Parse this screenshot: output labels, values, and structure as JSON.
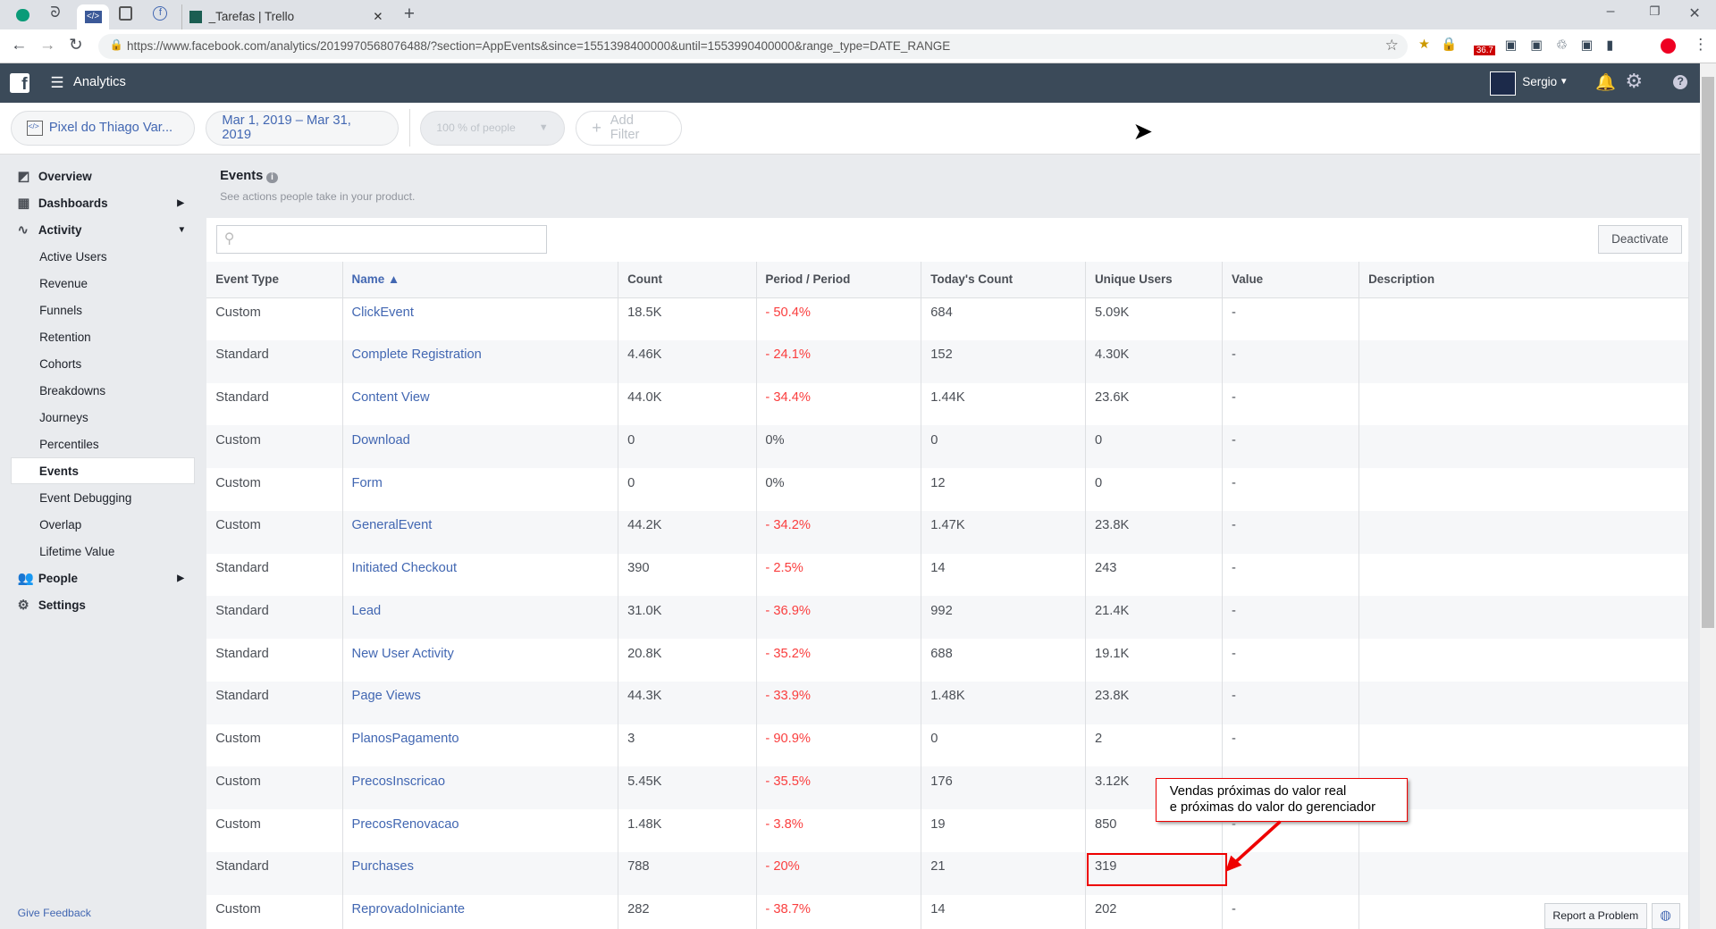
{
  "browser": {
    "tabs": [
      "_Tarefas | Trello"
    ],
    "url": "https://www.facebook.com/analytics/2019970568076488/?section=AppEvents&since=1551398400000&until=1553990400000&range_type=DATE_RANGE",
    "ext_badge": "36.7"
  },
  "header": {
    "app": "Analytics",
    "user": "Sergio"
  },
  "filters": {
    "pixel": "Pixel do Thiago Var...",
    "date": "Mar 1, 2019 – Mar 31, 2019",
    "people": "100 % of people",
    "add_filter": "Add Filter"
  },
  "sidebar": {
    "overview": "Overview",
    "dashboards": "Dashboards",
    "activity": "Activity",
    "sub": [
      "Active Users",
      "Revenue",
      "Funnels",
      "Retention",
      "Cohorts",
      "Breakdowns",
      "Journeys",
      "Percentiles",
      "Events",
      "Event Debugging",
      "Overlap",
      "Lifetime Value"
    ],
    "people": "People",
    "settings": "Settings",
    "feedback": "Give Feedback"
  },
  "page": {
    "title": "Events",
    "subtitle": "See actions people take in your product.",
    "deactivate": "Deactivate",
    "report": "Report a Problem"
  },
  "table": {
    "headers": [
      "Event Type",
      "Name ▲",
      "Count",
      "Period / Period",
      "Today's Count",
      "Unique Users",
      "Value",
      "Description"
    ],
    "rows": [
      [
        "Custom",
        "ClickEvent",
        "18.5K",
        "- 50.4%",
        "684",
        "5.09K",
        "-",
        ""
      ],
      [
        "Standard",
        "Complete Registration",
        "4.46K",
        "- 24.1%",
        "152",
        "4.30K",
        "-",
        ""
      ],
      [
        "Standard",
        "Content View",
        "44.0K",
        "- 34.4%",
        "1.44K",
        "23.6K",
        "-",
        ""
      ],
      [
        "Custom",
        "Download",
        "0",
        "0%",
        "0",
        "0",
        "-",
        ""
      ],
      [
        "Custom",
        "Form",
        "0",
        "0%",
        "12",
        "0",
        "-",
        ""
      ],
      [
        "Custom",
        "GeneralEvent",
        "44.2K",
        "- 34.2%",
        "1.47K",
        "23.8K",
        "-",
        ""
      ],
      [
        "Standard",
        "Initiated Checkout",
        "390",
        "- 2.5%",
        "14",
        "243",
        "-",
        ""
      ],
      [
        "Standard",
        "Lead",
        "31.0K",
        "- 36.9%",
        "992",
        "21.4K",
        "-",
        ""
      ],
      [
        "Standard",
        "New User Activity",
        "20.8K",
        "- 35.2%",
        "688",
        "19.1K",
        "-",
        ""
      ],
      [
        "Standard",
        "Page Views",
        "44.3K",
        "- 33.9%",
        "1.48K",
        "23.8K",
        "-",
        ""
      ],
      [
        "Custom",
        "PlanosPagamento",
        "3",
        "- 90.9%",
        "0",
        "2",
        "-",
        ""
      ],
      [
        "Custom",
        "PrecosInscricao",
        "5.45K",
        "- 35.5%",
        "176",
        "3.12K",
        "-",
        ""
      ],
      [
        "Custom",
        "PrecosRenovacao",
        "1.48K",
        "- 3.8%",
        "19",
        "850",
        "-",
        ""
      ],
      [
        "Standard",
        "Purchases",
        "788",
        "- 20%",
        "21",
        "319",
        "-",
        ""
      ],
      [
        "Custom",
        "ReprovadoIniciante",
        "282",
        "- 38.7%",
        "14",
        "202",
        "-",
        ""
      ]
    ]
  },
  "annotation": {
    "line1": "Vendas próximas do valor real",
    "line2": "e próximas do valor do gerenciador"
  }
}
